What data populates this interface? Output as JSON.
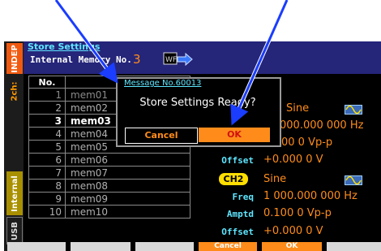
{
  "sidebar": {
    "indep": "INDEP",
    "ch2": "2ch:",
    "internal": "Internal",
    "usb": "USB"
  },
  "header": {
    "title": "Store Settings",
    "memory_label": "Internal Memory No.",
    "memory_value": "3",
    "wf_label": "WF"
  },
  "list": {
    "header_no": "No.",
    "rows": [
      {
        "no": "1",
        "name": "mem01"
      },
      {
        "no": "2",
        "name": "mem02"
      },
      {
        "no": "3",
        "name": "mem03"
      },
      {
        "no": "4",
        "name": "mem04"
      },
      {
        "no": "5",
        "name": "mem05"
      },
      {
        "no": "6",
        "name": "mem06"
      },
      {
        "no": "7",
        "name": "mem07"
      },
      {
        "no": "8",
        "name": "mem08"
      },
      {
        "no": "9",
        "name": "mem09"
      },
      {
        "no": "10",
        "name": "mem10"
      }
    ]
  },
  "ch1": {
    "type": "Sine",
    "freq_value": "000.000 000 Hz",
    "amptd_value": "00 0 Vp-p",
    "offset_label": "Offset",
    "offset_value": "+0.000 0 V"
  },
  "ch2": {
    "badge": "CH2",
    "type": "Sine",
    "freq_label": "Freq",
    "freq_value": "1 000.000 000 Hz",
    "amptd_label": "Amptd",
    "amptd_value": "0.100 0 Vp-p",
    "offset_label": "Offset",
    "offset_value": "+0.000 0 V"
  },
  "dialog": {
    "title": "Message No.60013",
    "message": "Store Settings Ready?",
    "cancel": "Cancel",
    "ok": "OK"
  },
  "softkeys": {
    "cancel": "Cancel",
    "ok": "OK"
  },
  "colors": {
    "accent": "#ff8c1a",
    "cyan": "#5ee6ff",
    "header_bg": "#25257a",
    "arrow": "#1a3dff"
  }
}
